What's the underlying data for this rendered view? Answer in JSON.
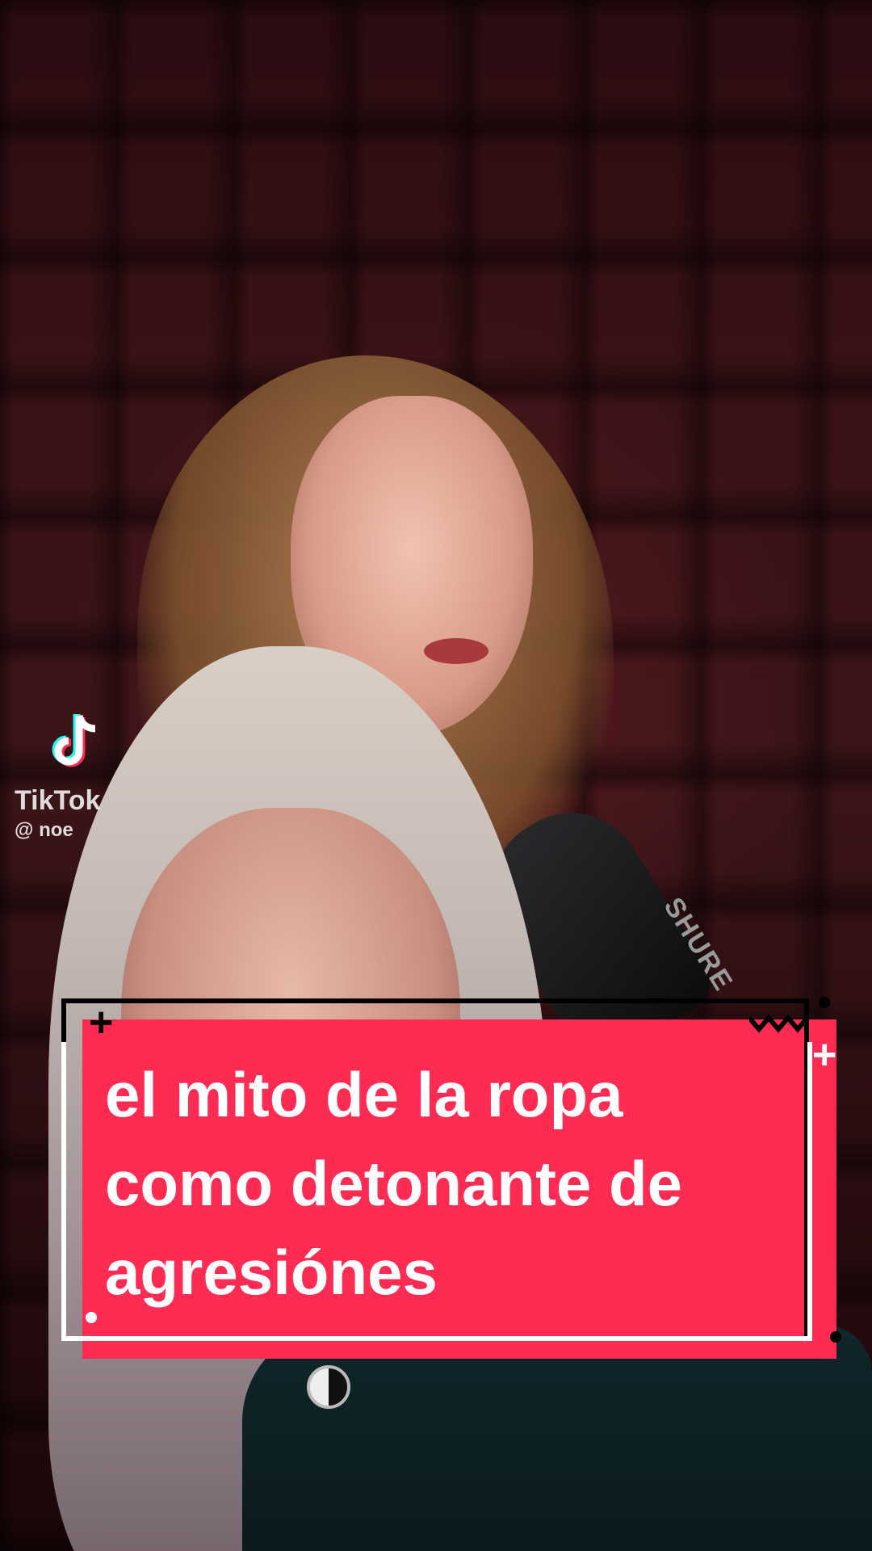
{
  "watermark": {
    "brand": "TikTok",
    "username": "@ noe"
  },
  "mic": {
    "label": "SHURE"
  },
  "caption": {
    "lines": [
      "el mito de la ropa",
      "como detonante de",
      "agresiónes"
    ],
    "card_color": "#fe2b52",
    "text_color": "#ffffff"
  },
  "icons": {
    "watermark_logo": "tiktok-logo-icon",
    "decorations": [
      "plus-icon",
      "zigzag-icon",
      "dot-icon"
    ]
  }
}
